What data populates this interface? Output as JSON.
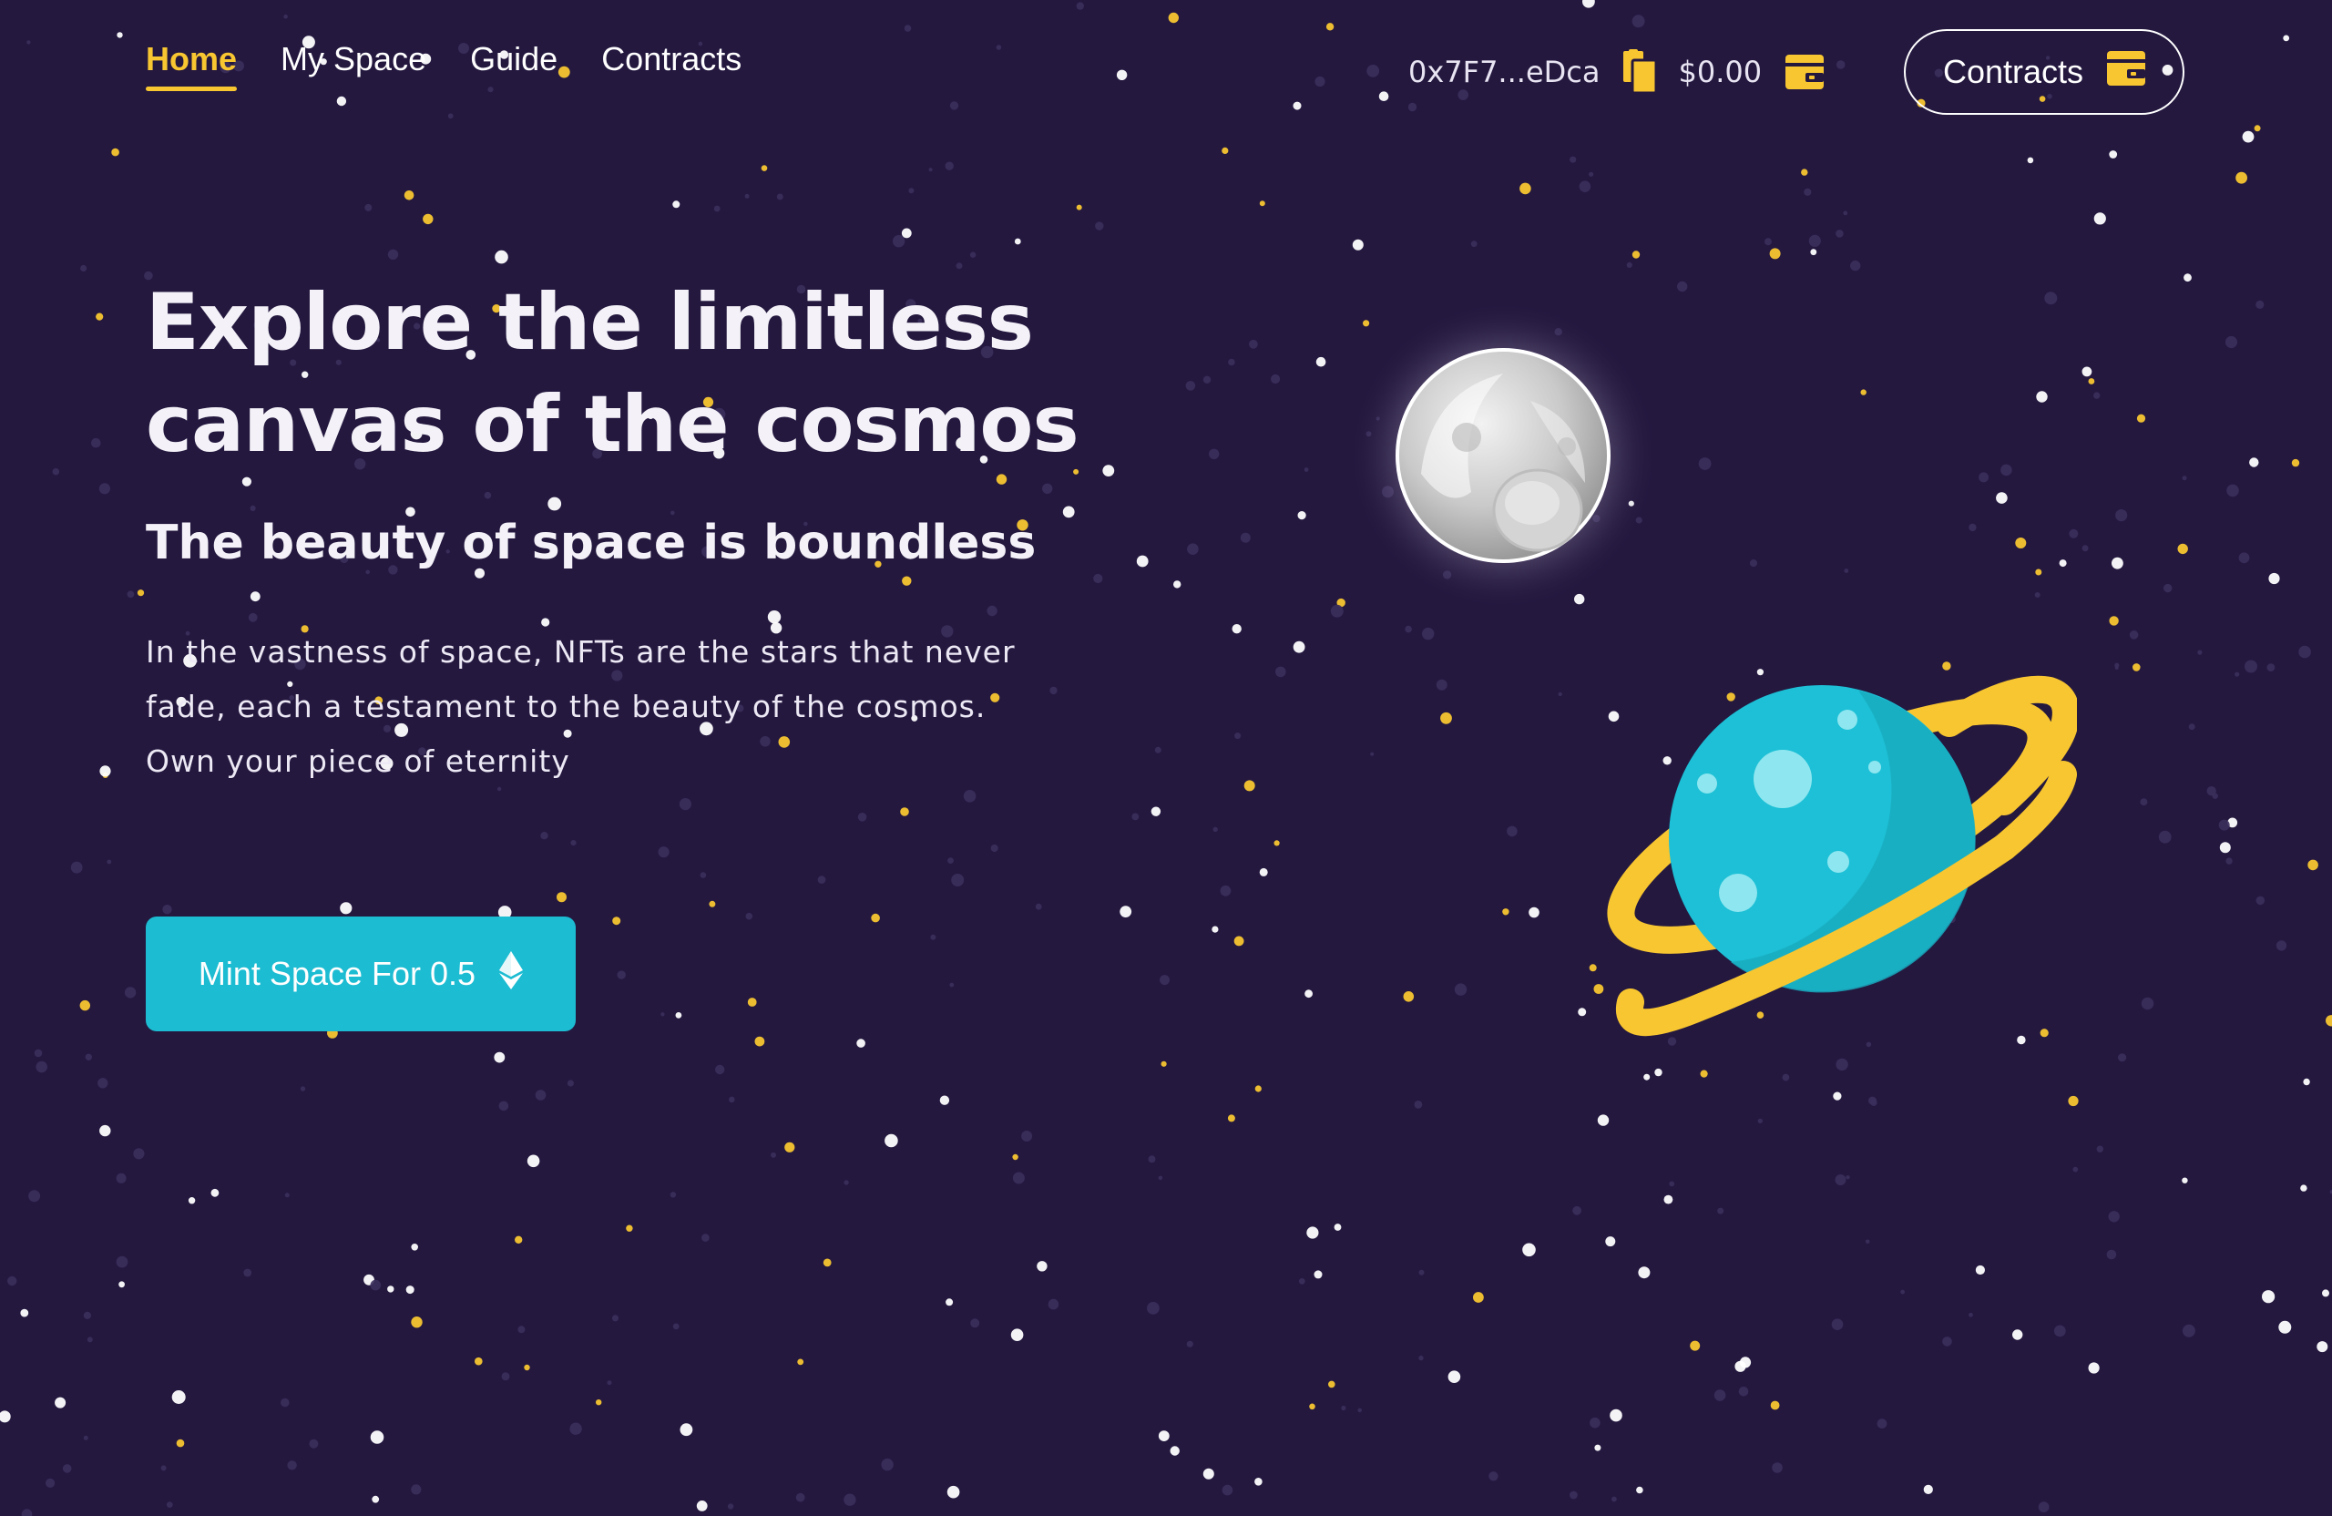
{
  "nav": {
    "links": [
      {
        "label": "Home",
        "active": true
      },
      {
        "label": "My Space",
        "active": false
      },
      {
        "label": "Guide",
        "active": false
      },
      {
        "label": "Contracts",
        "active": false
      }
    ]
  },
  "wallet": {
    "address": "0x7F7...eDca",
    "balance": "$0.00",
    "copy_icon": "copy-icon",
    "wallet_icon": "wallet-icon"
  },
  "header_button": {
    "label": "Contracts",
    "icon": "wallet-icon"
  },
  "hero": {
    "title_line1": "Explore the limitless",
    "title_line2": "canvas of the cosmos",
    "subtitle": "The beauty of space is boundless",
    "text_line1": "In the vastness of space, NFTs are the stars that never",
    "text_line2": "fade, each a testament to the beauty of the cosmos.",
    "text_line3": "Own your piece of eternity",
    "mint_label": "Mint Space For 0.5",
    "mint_icon": "ethereum-icon"
  },
  "colors": {
    "background": "#24183f",
    "accent_yellow": "#f8c630",
    "accent_cyan": "#1cbcd2",
    "text": "#f4f2f8"
  }
}
